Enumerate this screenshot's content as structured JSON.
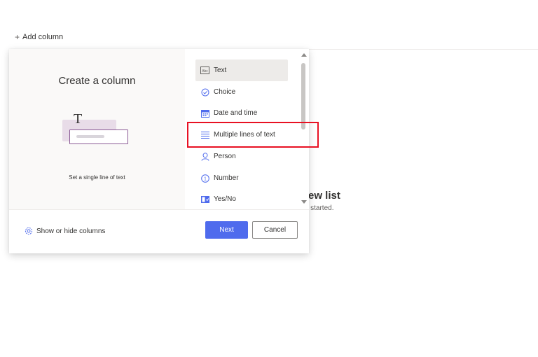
{
  "toolbar": {
    "add_column_label": "Add column"
  },
  "background": {
    "title_fragment": "ew list",
    "subtitle_fragment": "et started."
  },
  "panel": {
    "title": "Create a column",
    "preview_description": "Set a single line of text",
    "column_types": [
      {
        "label": "Text",
        "icon": "text-box-icon",
        "selected": true
      },
      {
        "label": "Choice",
        "icon": "choice-check-icon",
        "selected": false
      },
      {
        "label": "Date and time",
        "icon": "calendar-icon",
        "selected": false
      },
      {
        "label": "Multiple lines of text",
        "icon": "multiline-text-icon",
        "selected": false
      },
      {
        "label": "Person",
        "icon": "person-icon",
        "selected": false
      },
      {
        "label": "Number",
        "icon": "number-icon",
        "selected": false
      },
      {
        "label": "Yes/No",
        "icon": "yes-no-toggle-icon",
        "selected": false
      }
    ],
    "footer": {
      "show_hide_label": "Show or hide columns",
      "next_label": "Next",
      "cancel_label": "Cancel"
    }
  },
  "colors": {
    "accent": "#4f6bed",
    "highlight": "#e81123",
    "icon": "#4f6bed"
  }
}
